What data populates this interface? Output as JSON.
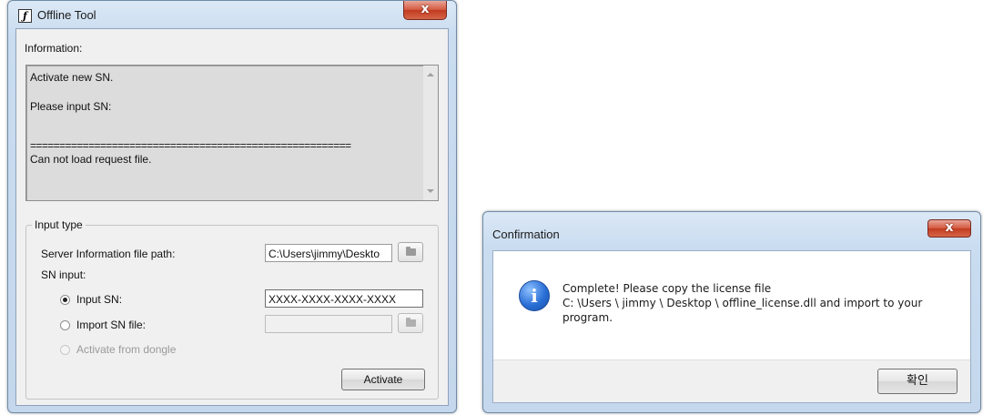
{
  "offline_tool": {
    "title": "Offline Tool",
    "close_label": "x",
    "information_label": "Information:",
    "info_lines": [
      "Activate new SN.",
      "Please input SN:",
      "=======================================================",
      "Can not load request file."
    ],
    "input_type": {
      "group_title": "Input type",
      "server_path_label": "Server Information file path:",
      "server_path_value": "C:\\Users\\jimmy\\Deskto",
      "sn_input_label": "SN input:",
      "input_sn_label": "Input SN:",
      "input_sn_value": "XXXX-XXXX-XXXX-XXXX",
      "import_sn_label": "Import SN file:",
      "import_sn_value": "",
      "dongle_label": "Activate from dongle",
      "selected_option": "Input SN",
      "activate_label": "Activate"
    }
  },
  "confirmation": {
    "title": "Confirmation",
    "close_label": "x",
    "message_lines": [
      "Complete! Please copy the license file",
      "C: \\Users \\ jimmy \\ Desktop \\ offline_license.dll and import to your",
      "program."
    ],
    "ok_label": "확인",
    "icon": "info-icon"
  }
}
